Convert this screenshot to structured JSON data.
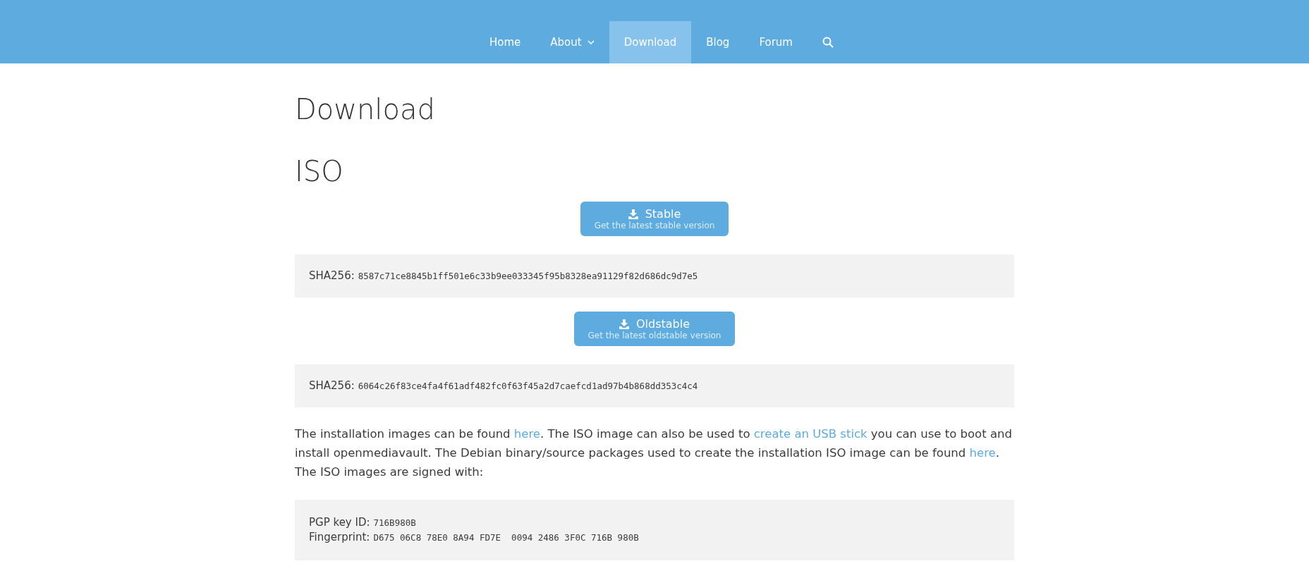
{
  "nav": {
    "items": [
      {
        "label": "Home",
        "selected": false,
        "dropdown": false
      },
      {
        "label": "About",
        "selected": false,
        "dropdown": true
      },
      {
        "label": "Download",
        "selected": true,
        "dropdown": false
      },
      {
        "label": "Blog",
        "selected": false,
        "dropdown": false
      },
      {
        "label": "Forum",
        "selected": false,
        "dropdown": false
      }
    ]
  },
  "title": "Download",
  "section": "ISO",
  "releases": [
    {
      "button": {
        "label": "Stable",
        "sublabel": "Get the latest stable version"
      },
      "hash_label": "SHA256:",
      "hash": "8587c71ce8845b1ff501e6c33b9ee033345f95b8328ea91129f82d686dc9d7e5"
    },
    {
      "button": {
        "label": "Oldstable",
        "sublabel": "Get the latest oldstable version"
      },
      "hash_label": "SHA256:",
      "hash": "6064c26f83ce4fa4f61adf482fc0f63f45a2d7caefcd1ad97b4b868dd353c4c4"
    }
  ],
  "paragraph": [
    {
      "kind": "text",
      "text": "The installation images can be found "
    },
    {
      "kind": "link",
      "text": "here"
    },
    {
      "kind": "text",
      "text": ". The ISO image can also be used to "
    },
    {
      "kind": "link",
      "text": "create an USB stick"
    },
    {
      "kind": "text",
      "text": " you can use to boot and install openmediavault. The Debian binary/source packages used to create the installation ISO image can be found "
    },
    {
      "kind": "link",
      "text": "here"
    },
    {
      "kind": "text",
      "text": ". The ISO images are signed with:"
    }
  ],
  "signature": [
    {
      "label": "PGP key ID:",
      "value": "716B980B"
    },
    {
      "label": "Fingerprint:",
      "value": "D675 06C8 78E0 8A94 FD7E  0094 2486 3F0C 716B 980B"
    }
  ]
}
